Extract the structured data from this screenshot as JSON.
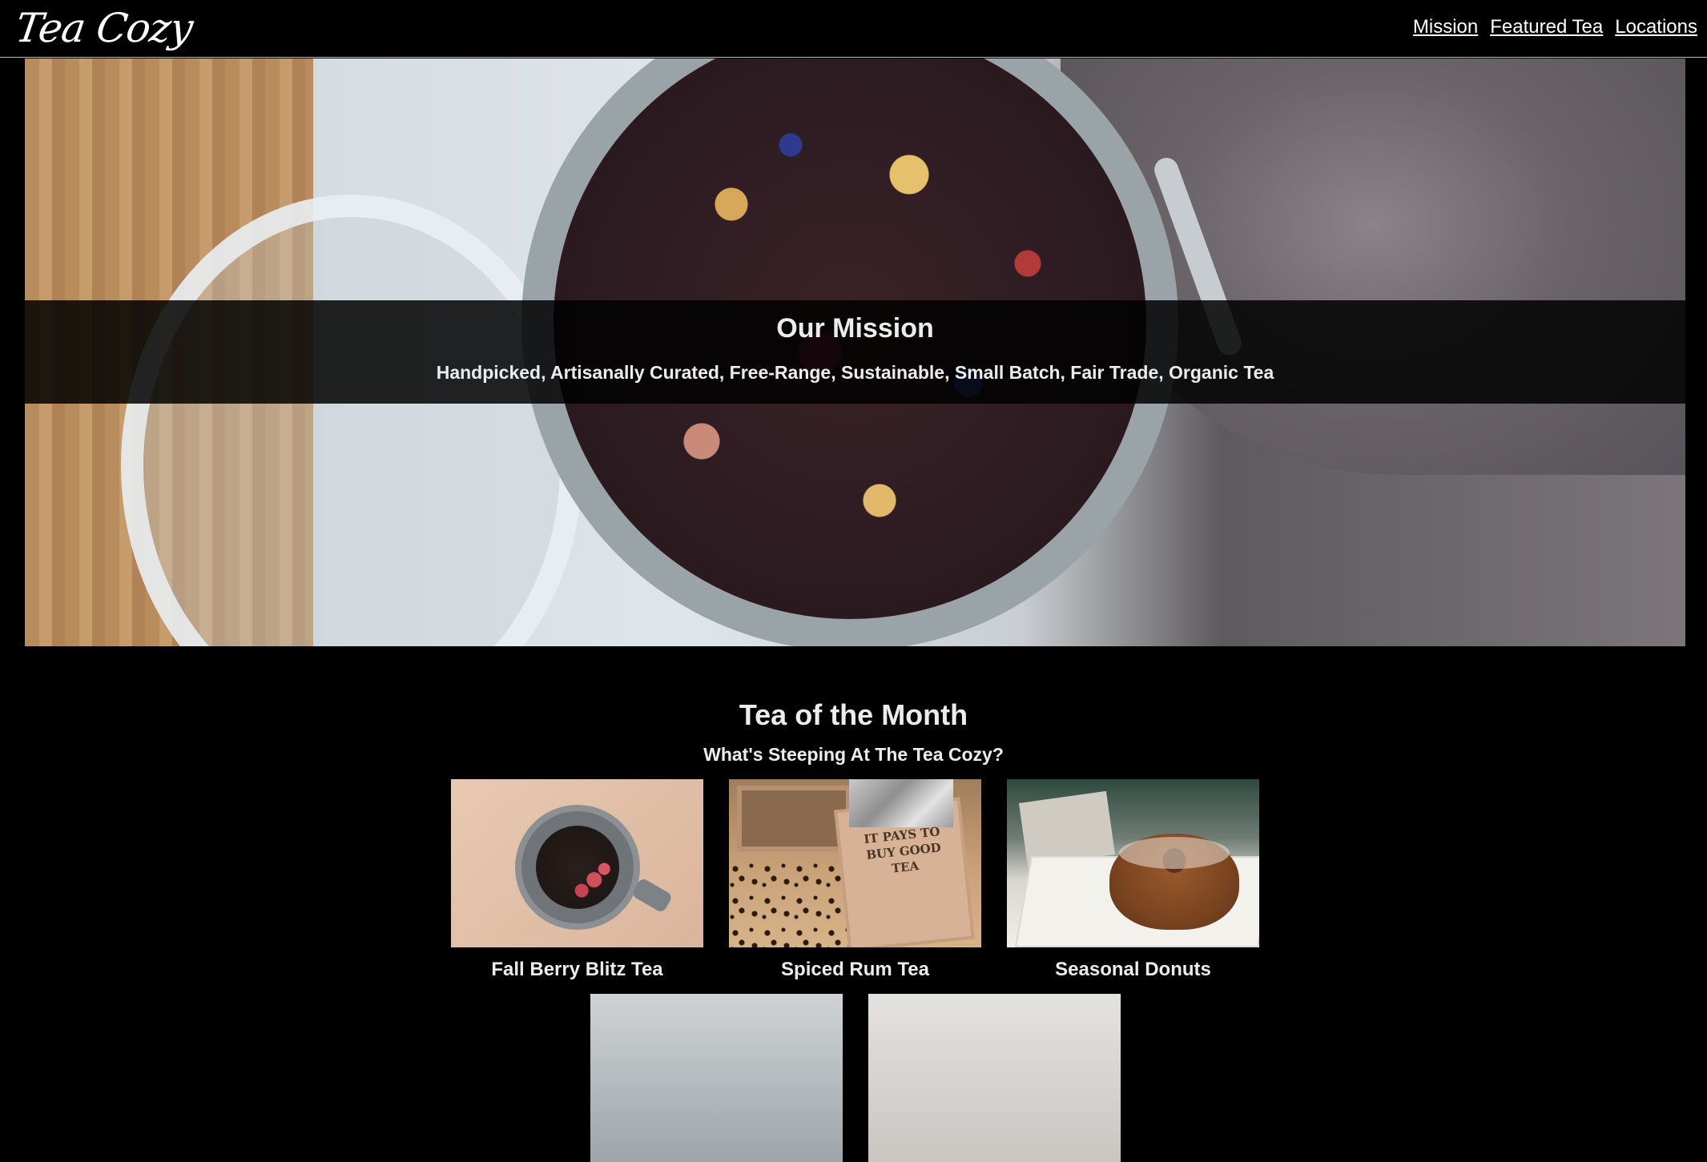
{
  "header": {
    "logo": "Tea Cozy",
    "nav": [
      {
        "label": "Mission"
      },
      {
        "label": "Featured Tea"
      },
      {
        "label": "Locations"
      }
    ]
  },
  "mission": {
    "title": "Our Mission",
    "text": "Handpicked, Artisanally Curated, Free-Range, Sustainable, Small Batch, Fair Trade, Organic Tea"
  },
  "tea_of_month": {
    "title": "Tea of the Month",
    "subtitle": "What's Steeping At The Tea Cozy?",
    "items": [
      {
        "caption": "Fall Berry Blitz Tea",
        "image": "mug-of-berry-tea-image"
      },
      {
        "caption": "Spiced Rum Tea",
        "image": "tea-box-image",
        "box_text": "IT PAYS TO BUY GOOD TEA"
      },
      {
        "caption": "Seasonal Donuts",
        "image": "donut-image"
      }
    ]
  },
  "colors": {
    "background": "#000000",
    "text": "#ececec",
    "header_border": "#bdbdbd"
  }
}
